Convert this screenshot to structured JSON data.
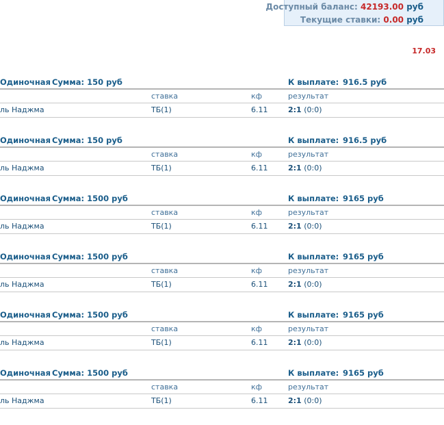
{
  "balance": {
    "available_label": "Доступный баланс:",
    "available_value": "42193.00",
    "current_label": "Текущие ставки:",
    "current_value": "0.00",
    "currency": "руб"
  },
  "date": "17.03",
  "columns": {
    "bet": "ставка",
    "coef": "кф",
    "result": "результат"
  },
  "labels": {
    "sum": "Сумма:",
    "payout": "К выплате:"
  },
  "bets": [
    {
      "type": "Одиночная",
      "sum": "150 руб",
      "payout": "916.5 руб",
      "match": "ль Наджма",
      "bet": "ТБ(1)",
      "coef": "6.11",
      "score": "2:1",
      "halftime": "(0:0)"
    },
    {
      "type": "Одиночная",
      "sum": "150 руб",
      "payout": "916.5 руб",
      "match": "ль Наджма",
      "bet": "ТБ(1)",
      "coef": "6.11",
      "score": "2:1",
      "halftime": "(0:0)"
    },
    {
      "type": "Одиночная",
      "sum": "1500 руб",
      "payout": "9165 руб",
      "match": "ль Наджма",
      "bet": "ТБ(1)",
      "coef": "6.11",
      "score": "2:1",
      "halftime": "(0:0)"
    },
    {
      "type": "Одиночная",
      "sum": "1500 руб",
      "payout": "9165 руб",
      "match": "ль Наджма",
      "bet": "ТБ(1)",
      "coef": "6.11",
      "score": "2:1",
      "halftime": "(0:0)"
    },
    {
      "type": "Одиночная",
      "sum": "1500 руб",
      "payout": "9165 руб",
      "match": "ль Наджма",
      "bet": "ТБ(1)",
      "coef": "6.11",
      "score": "2:1",
      "halftime": "(0:0)"
    },
    {
      "type": "Одиночная",
      "sum": "1500 руб",
      "payout": "9165 руб",
      "match": "ль Наджма",
      "bet": "ТБ(1)",
      "coef": "6.11",
      "score": "2:1",
      "halftime": "(0:0)"
    }
  ]
}
